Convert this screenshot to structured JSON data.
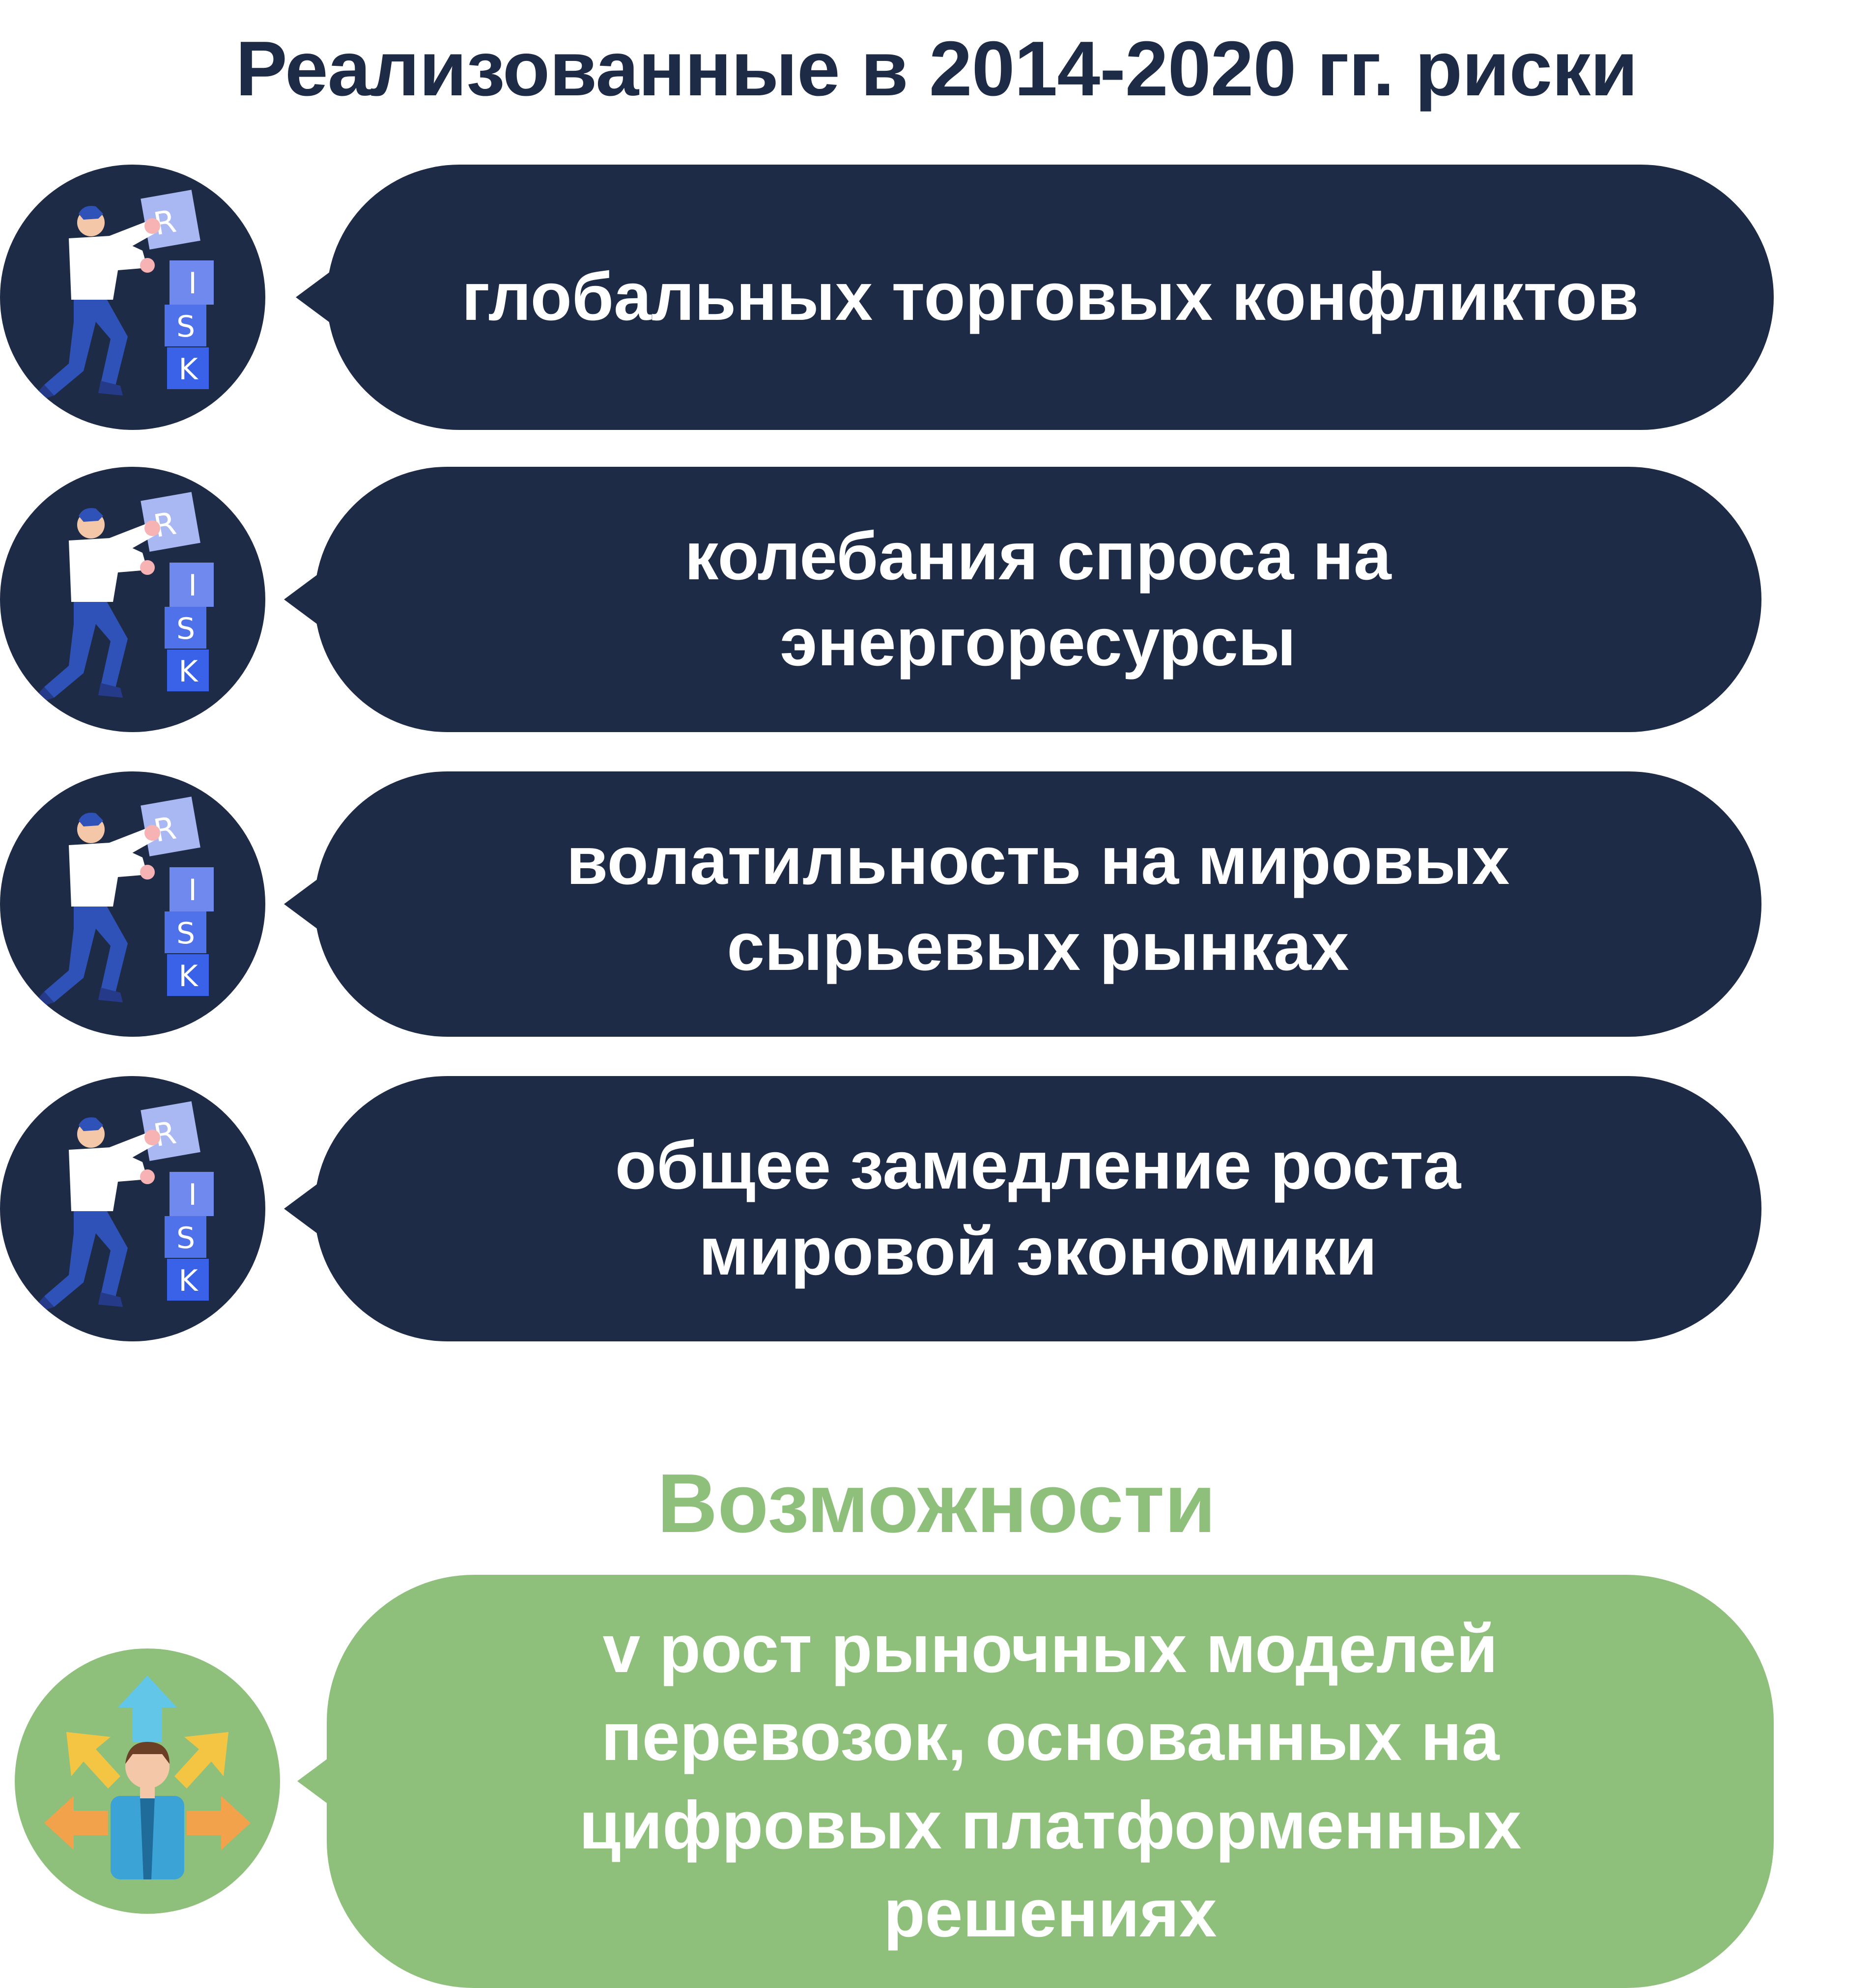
{
  "title": "Реализованные в 2014-2020 гг. риски",
  "risks": [
    {
      "text": "глобальных торговых конфликтов",
      "icon": "person-pushing-risk-blocks-icon"
    },
    {
      "text": "колебания спроса на энергоресурсы",
      "icon": "person-pushing-risk-blocks-icon"
    },
    {
      "text": "волатильность на мировых сырьевых рынках",
      "icon": "person-pushing-risk-blocks-icon"
    },
    {
      "text": "общее замедление роста мировой экономики",
      "icon": "person-pushing-risk-blocks-icon"
    }
  ],
  "risk_block_letters": [
    "R",
    "I",
    "S",
    "K"
  ],
  "opportunities_title": "Возможности",
  "opportunities": [
    {
      "text": "v рост рыночных моделей перевозок, основанных на цифровых платформенных решениях",
      "icon": "person-with-arrows-icon"
    }
  ],
  "colors": {
    "navy": "#1e2b47",
    "green": "#8ec07c"
  }
}
